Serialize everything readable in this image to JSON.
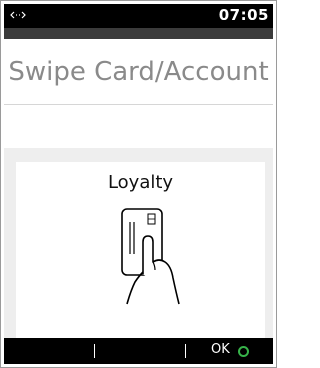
{
  "status_bar": {
    "time": "07:05",
    "connection_icon": "link-arrows-icon"
  },
  "screen": {
    "title": "Swipe Card/Account"
  },
  "card_panel": {
    "label": "Loyalty",
    "illustration_icon": "hand-swipe-card-icon"
  },
  "bottom_bar": {
    "ok_label": "OK",
    "ok_indicator_color": "#37b34a"
  }
}
